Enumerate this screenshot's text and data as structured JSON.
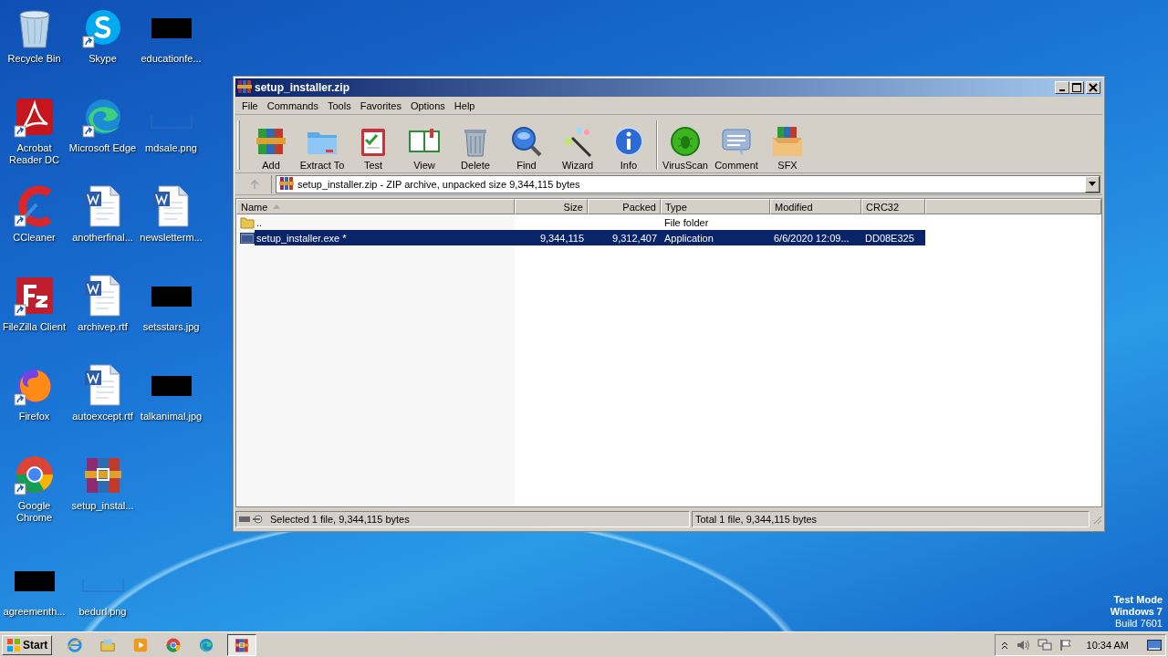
{
  "desktop": {
    "icons": [
      {
        "label": "Recycle Bin",
        "kind": "recycle",
        "shortcut": false
      },
      {
        "label": "Acrobat Reader DC",
        "kind": "acrobat",
        "shortcut": true
      },
      {
        "label": "CCleaner",
        "kind": "ccleaner",
        "shortcut": true
      },
      {
        "label": "FileZilla Client",
        "kind": "filezilla",
        "shortcut": true
      },
      {
        "label": "Firefox",
        "kind": "firefox",
        "shortcut": true
      },
      {
        "label": "Google Chrome",
        "kind": "chrome",
        "shortcut": true
      },
      {
        "label": "agreementh...",
        "kind": "dark-image",
        "shortcut": false
      },
      {
        "label": "Skype",
        "kind": "skype",
        "shortcut": true
      },
      {
        "label": "Microsoft Edge",
        "kind": "edge",
        "shortcut": true
      },
      {
        "label": "anotherfinal...",
        "kind": "word",
        "shortcut": false
      },
      {
        "label": "archivep.rtf",
        "kind": "word",
        "shortcut": false
      },
      {
        "label": "autoexcept.rtf",
        "kind": "word",
        "shortcut": false
      },
      {
        "label": "setup_instal...",
        "kind": "winrar",
        "shortcut": false
      },
      {
        "label": "bedurl.png",
        "kind": "blank-image",
        "shortcut": false
      },
      {
        "label": "educationfe...",
        "kind": "dark-image",
        "shortcut": false
      },
      {
        "label": "mdsale.png",
        "kind": "blank-image",
        "shortcut": false
      },
      {
        "label": "newsletterm...",
        "kind": "word",
        "shortcut": false
      },
      {
        "label": "setsstars.jpg",
        "kind": "dark-image",
        "shortcut": false
      },
      {
        "label": "talkanimal.jpg",
        "kind": "dark-image",
        "shortcut": false
      }
    ],
    "system_notice": [
      "Test Mode",
      "Windows 7",
      "Build 7601"
    ]
  },
  "window": {
    "title": "setup_installer.zip",
    "menu": [
      "File",
      "Commands",
      "Tools",
      "Favorites",
      "Options",
      "Help"
    ],
    "toolbar": [
      {
        "label": "Add",
        "kind": "add"
      },
      {
        "label": "Extract To",
        "kind": "extract"
      },
      {
        "label": "Test",
        "kind": "test"
      },
      {
        "label": "View",
        "kind": "view"
      },
      {
        "label": "Delete",
        "kind": "delete"
      },
      {
        "label": "Find",
        "kind": "find"
      },
      {
        "label": "Wizard",
        "kind": "wizard"
      },
      {
        "label": "Info",
        "kind": "info"
      },
      {
        "label": "VirusScan",
        "kind": "virus"
      },
      {
        "label": "Comment",
        "kind": "comment"
      },
      {
        "label": "SFX",
        "kind": "sfx"
      }
    ],
    "address": "setup_installer.zip - ZIP archive, unpacked size 9,344,115 bytes",
    "columns": [
      {
        "label": "Name",
        "sorted": true
      },
      {
        "label": "Size",
        "sorted": false
      },
      {
        "label": "Packed",
        "sorted": false
      },
      {
        "label": "Type",
        "sorted": false
      },
      {
        "label": "Modified",
        "sorted": false
      },
      {
        "label": "CRC32",
        "sorted": false
      }
    ],
    "rows": [
      {
        "kind": "folder",
        "selected": false,
        "cells": [
          "..",
          "",
          "",
          "File folder",
          "",
          ""
        ]
      },
      {
        "kind": "exe",
        "selected": true,
        "cells": [
          "setup_installer.exe *",
          "9,344,115",
          "9,312,407",
          "Application",
          "6/6/2020 12:09...",
          "DD08E325"
        ]
      }
    ],
    "status_bar": [
      "Selected 1 file, 9,344,115 bytes",
      "Total 1 file, 9,344,115 bytes"
    ]
  },
  "taskbar": {
    "start": "Start",
    "apps": [
      {
        "kind": "ie",
        "active": false
      },
      {
        "kind": "explorer",
        "active": false
      },
      {
        "kind": "media",
        "active": false
      },
      {
        "kind": "chrome",
        "active": false
      },
      {
        "kind": "edge",
        "active": false
      },
      {
        "kind": "winrar",
        "active": true
      }
    ],
    "time": "10:34 AM"
  }
}
